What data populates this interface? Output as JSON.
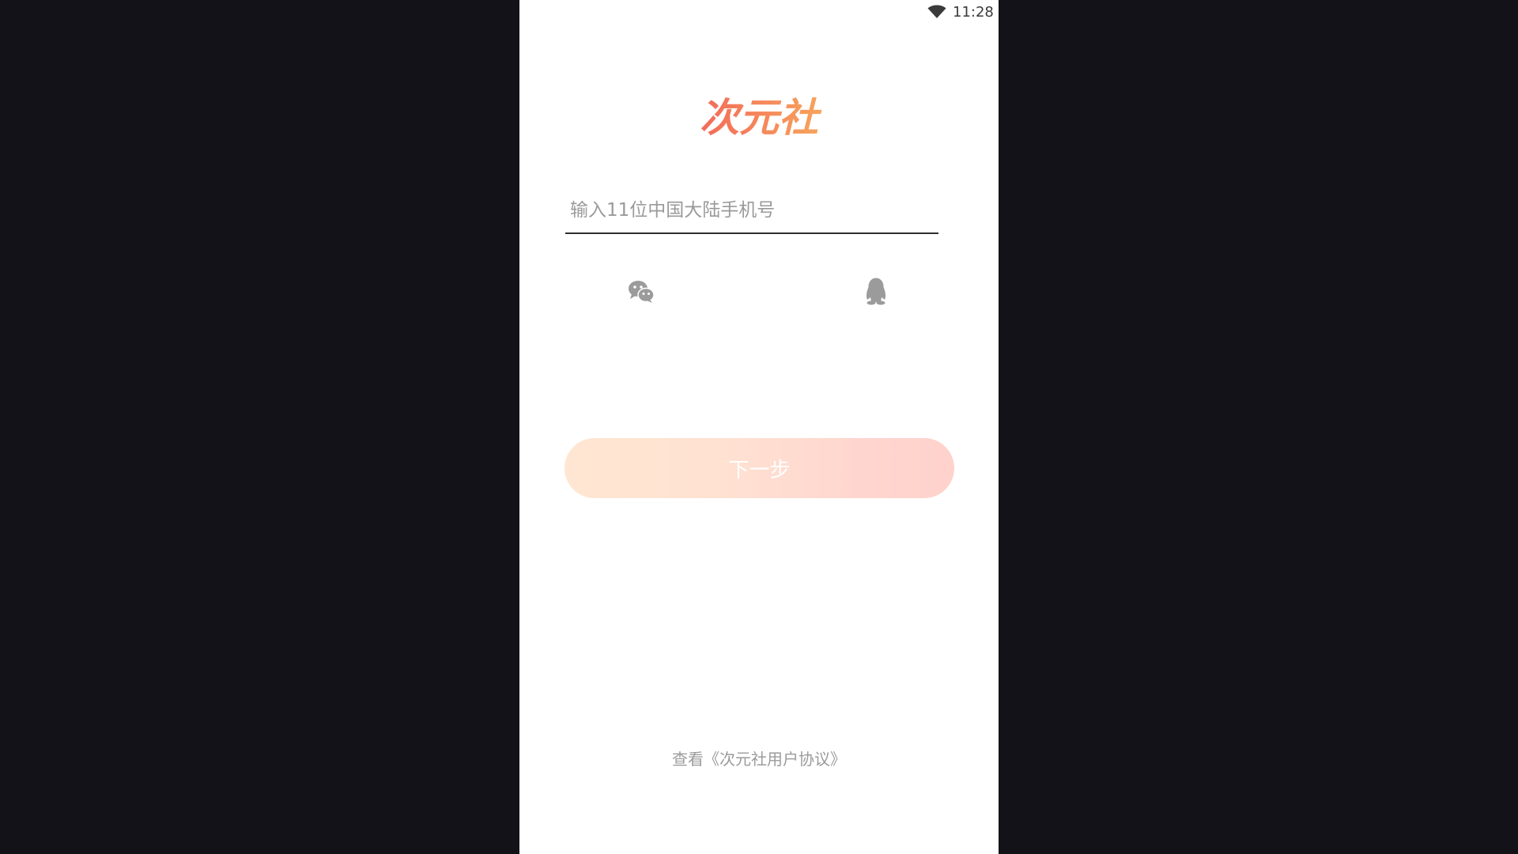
{
  "status_bar": {
    "time": "11:28",
    "wifi_icon": "wifi-icon"
  },
  "logo": {
    "text": "次元社",
    "colors": [
      "#f36a5b",
      "#f7a45c"
    ]
  },
  "login": {
    "phone_placeholder": "输入11位中国大陆手机号",
    "phone_value": "",
    "social": [
      {
        "icon": "wechat-icon"
      },
      {
        "icon": "qq-icon"
      }
    ],
    "next_label": "下一步",
    "agreement_label": "查看《次元社用户协议》"
  },
  "colors": {
    "backdrop": "#131218",
    "button_gradient_start": "#ffe6d2",
    "button_gradient_end": "#ffd2cc",
    "icon_gray": "#9b9b9b"
  }
}
